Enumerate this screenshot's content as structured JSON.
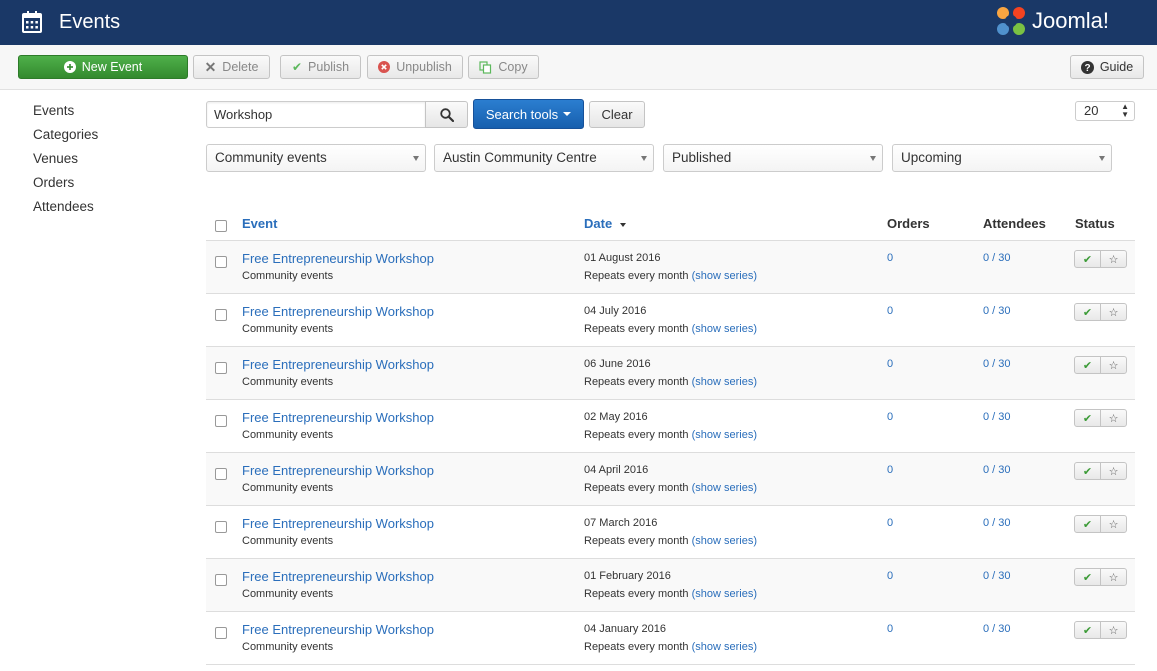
{
  "header": {
    "title": "Events",
    "logo_text": "Joomla!"
  },
  "toolbar": {
    "new_label": "New Event",
    "delete_label": "Delete",
    "publish_label": "Publish",
    "unpublish_label": "Unpublish",
    "copy_label": "Copy",
    "guide_label": "Guide"
  },
  "sidebar": {
    "items": [
      {
        "label": "Events"
      },
      {
        "label": "Categories"
      },
      {
        "label": "Venues"
      },
      {
        "label": "Orders"
      },
      {
        "label": "Attendees"
      }
    ]
  },
  "filters": {
    "search_value": "Workshop",
    "search_tools_label": "Search tools",
    "clear_label": "Clear",
    "limit": "20",
    "category": "Community events",
    "venue": "Austin Community Centre",
    "state": "Published",
    "time": "Upcoming"
  },
  "table": {
    "headers": {
      "event": "Event",
      "date": "Date",
      "orders": "Orders",
      "attendees": "Attendees",
      "status": "Status"
    },
    "rows": [
      {
        "title": "Free Entrepreneurship Workshop",
        "category": "Community events",
        "date": "01 August 2016",
        "repeat": "Repeats every month",
        "series": "(show series)",
        "orders": "0",
        "attendees": "0 / 30"
      },
      {
        "title": "Free Entrepreneurship Workshop",
        "category": "Community events",
        "date": "04 July 2016",
        "repeat": "Repeats every month",
        "series": "(show series)",
        "orders": "0",
        "attendees": "0 / 30"
      },
      {
        "title": "Free Entrepreneurship Workshop",
        "category": "Community events",
        "date": "06 June 2016",
        "repeat": "Repeats every month",
        "series": "(show series)",
        "orders": "0",
        "attendees": "0 / 30"
      },
      {
        "title": "Free Entrepreneurship Workshop",
        "category": "Community events",
        "date": "02 May 2016",
        "repeat": "Repeats every month",
        "series": "(show series)",
        "orders": "0",
        "attendees": "0 / 30"
      },
      {
        "title": "Free Entrepreneurship Workshop",
        "category": "Community events",
        "date": "04 April 2016",
        "repeat": "Repeats every month",
        "series": "(show series)",
        "orders": "0",
        "attendees": "0 / 30"
      },
      {
        "title": "Free Entrepreneurship Workshop",
        "category": "Community events",
        "date": "07 March 2016",
        "repeat": "Repeats every month",
        "series": "(show series)",
        "orders": "0",
        "attendees": "0 / 30"
      },
      {
        "title": "Free Entrepreneurship Workshop",
        "category": "Community events",
        "date": "01 February 2016",
        "repeat": "Repeats every month",
        "series": "(show series)",
        "orders": "0",
        "attendees": "0 / 30"
      },
      {
        "title": "Free Entrepreneurship Workshop",
        "category": "Community events",
        "date": "04 January 2016",
        "repeat": "Repeats every month",
        "series": "(show series)",
        "orders": "0",
        "attendees": "0 / 30"
      }
    ]
  },
  "colors": {
    "header_bg": "#1a3867",
    "link": "#2a6ebb",
    "success": "#3c9b37",
    "primary": "#1f6ec0"
  }
}
